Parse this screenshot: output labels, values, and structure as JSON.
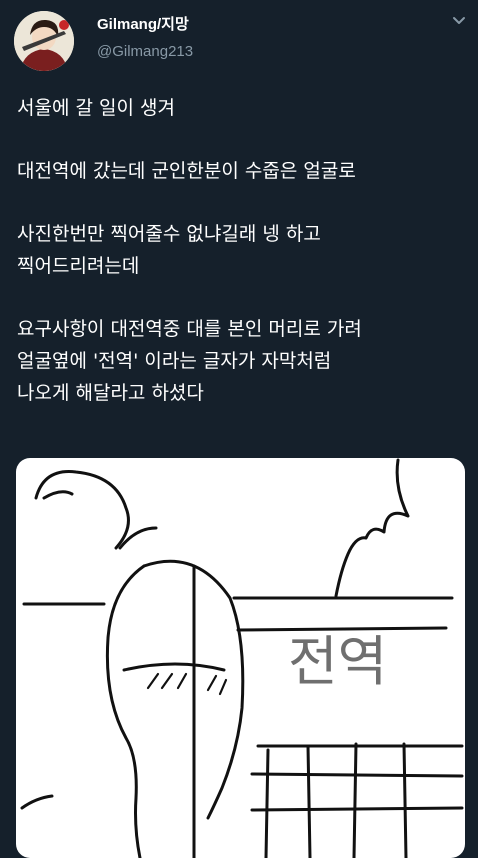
{
  "user": {
    "display_name": "Gilmang/지망",
    "handle": "@Gilmang213"
  },
  "tweet": {
    "lines": [
      "서울에 갈 일이 생겨",
      "대전역에 갔는데 군인한분이 수줍은 얼굴로",
      "사진한번만 찍어줄수 없냐길래 넹 하고",
      "찍어드리려는데",
      "요구사항이 대전역중 대를 본인 머리로 가려",
      "얼굴옆에 '전역' 이라는 글자가 자막처럼",
      "나오게 해달라고 하셨다"
    ]
  },
  "media": {
    "drawing_text": "전역"
  },
  "icons": {
    "menu": "chevron-down-icon",
    "avatar": "avatar"
  },
  "colors": {
    "background": "#15202b",
    "text": "#ffffff",
    "secondary": "#8899a6"
  }
}
